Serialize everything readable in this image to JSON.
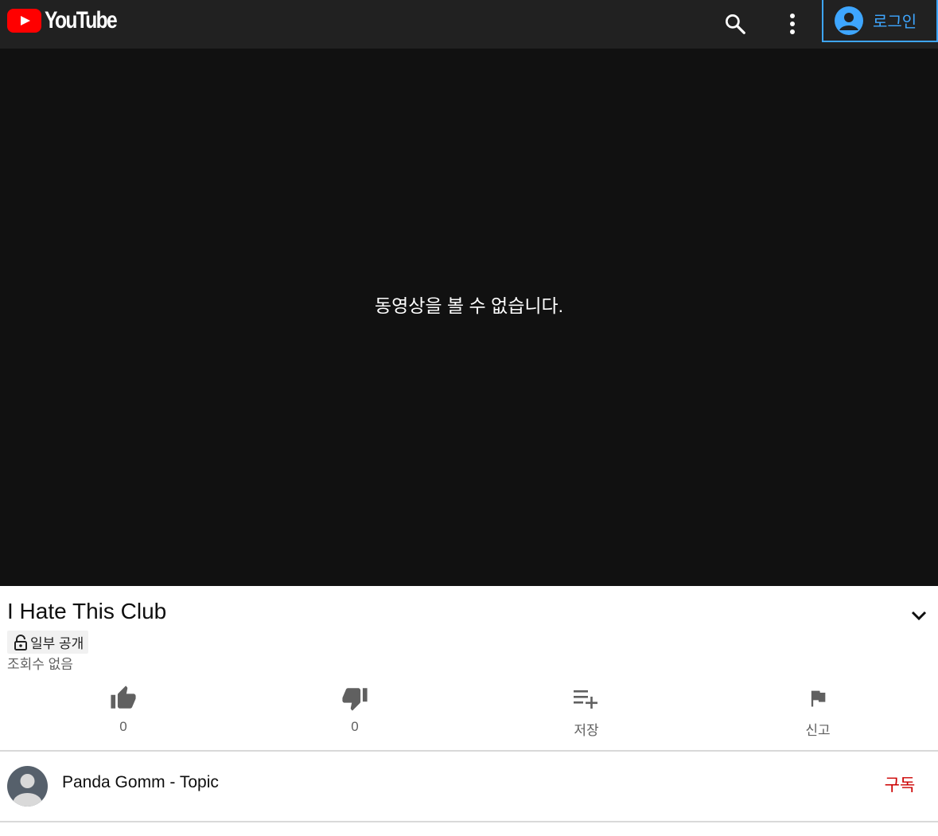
{
  "header": {
    "logo_text": "YouTube",
    "login_label": "로그인",
    "accent_color": "#3ea6ff",
    "icons": [
      "youtube-logo-icon",
      "search-icon",
      "more-vert-icon",
      "account-circle-icon"
    ]
  },
  "player": {
    "message": "동영상을 볼 수 없습니다."
  },
  "video": {
    "title": "I Hate This Club",
    "privacy_label": "일부 공개",
    "views_text": "조회수 없음"
  },
  "actions": {
    "like_count": "0",
    "dislike_count": "0",
    "save_label": "저장",
    "report_label": "신고"
  },
  "channel": {
    "name": "Panda Gomm - Topic",
    "subscribe_label": "구독",
    "subscribe_color": "#cc0000"
  }
}
